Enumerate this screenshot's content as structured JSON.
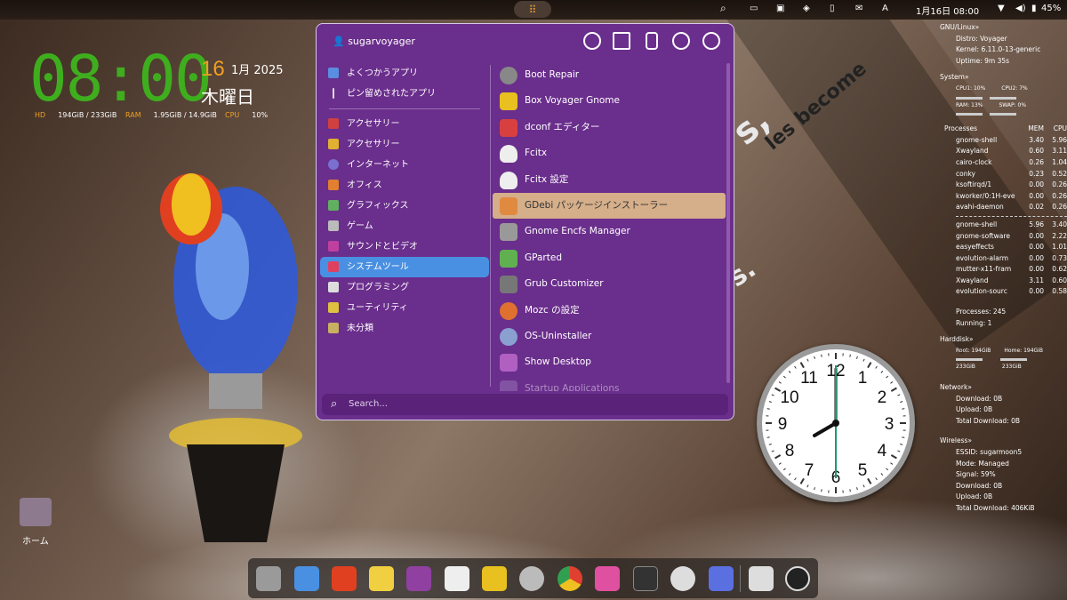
{
  "topbar": {
    "date_time": "1月16日 08:00",
    "battery": "45%",
    "input_method": "A"
  },
  "conky_left": {
    "time": "08:00",
    "day": "16",
    "month_year": "1月 2025",
    "weekday": "木曜日",
    "hd_label": "HD",
    "hd_value": "194GiB / 233GiB",
    "ram_label": "RAM",
    "ram_value": "1.95GiB / 14.9GiB",
    "cpu_label": "CPU",
    "cpu_value": "10%"
  },
  "menu": {
    "user": "sugarvoyager",
    "categories": [
      {
        "label": "よくつかうアプリ"
      },
      {
        "label": "ピン留めされたアプリ"
      },
      {
        "label": "アクセサリー"
      },
      {
        "label": "アクセサリー"
      },
      {
        "label": "インターネット"
      },
      {
        "label": "オフィス"
      },
      {
        "label": "グラフィックス"
      },
      {
        "label": "ゲーム"
      },
      {
        "label": "サウンドとビデオ"
      },
      {
        "label": "システムツール"
      },
      {
        "label": "プログラミング"
      },
      {
        "label": "ユーティリティ"
      },
      {
        "label": "未分類"
      }
    ],
    "apps": [
      {
        "label": "Boot Repair"
      },
      {
        "label": "Box Voyager Gnome"
      },
      {
        "label": "dconf エディター"
      },
      {
        "label": "Fcitx"
      },
      {
        "label": "Fcitx 設定"
      },
      {
        "label": "GDebi パッケージインストーラー"
      },
      {
        "label": "Gnome Encfs Manager"
      },
      {
        "label": "GParted"
      },
      {
        "label": "Grub Customizer"
      },
      {
        "label": "Mozc の設定"
      },
      {
        "label": "OS-Uninstaller"
      },
      {
        "label": "Show Desktop"
      },
      {
        "label": "Startup Applications"
      }
    ],
    "search_placeholder": "Search..."
  },
  "conky_right": {
    "gnu_title": "GNU/Linux»",
    "distro": "Distro: Voyager",
    "kernel": "Kernel: 6.11.0-13-generic",
    "uptime": "Uptime: 9m 35s",
    "system_title": "System»",
    "cpu1": "CPU1: 10%",
    "cpu2": "CPU2: 7%",
    "ram": "RAM: 13%",
    "swap": "SWAP: 0%",
    "processes_title": "Processes",
    "mem_h": "MEM",
    "cpu_h": "CPU",
    "procs_a": [
      {
        "name": "gnome-shell",
        "mem": "3.40",
        "cpu": "5.96"
      },
      {
        "name": "Xwayland",
        "mem": "0.60",
        "cpu": "3.11"
      },
      {
        "name": "cairo-clock",
        "mem": "0.26",
        "cpu": "1.04"
      },
      {
        "name": "conky",
        "mem": "0.23",
        "cpu": "0.52"
      },
      {
        "name": "ksoftirqd/1",
        "mem": "0.00",
        "cpu": "0.26"
      },
      {
        "name": "kworker/0:1H-eve",
        "mem": "0.00",
        "cpu": "0.26"
      },
      {
        "name": "avahi-daemon",
        "mem": "0.02",
        "cpu": "0.26"
      }
    ],
    "procs_b": [
      {
        "name": "gnome-shell",
        "mem": "5.96",
        "cpu": "3.40"
      },
      {
        "name": "gnome-software",
        "mem": "0.00",
        "cpu": "2.22"
      },
      {
        "name": "easyeffects",
        "mem": "0.00",
        "cpu": "1.01"
      },
      {
        "name": "evolution-alarm",
        "mem": "0.00",
        "cpu": "0.73"
      },
      {
        "name": "mutter-x11-fram",
        "mem": "0.00",
        "cpu": "0.62"
      },
      {
        "name": "Xwayland",
        "mem": "3.11",
        "cpu": "0.60"
      },
      {
        "name": "evolution-sourc",
        "mem": "0.00",
        "cpu": "0.58"
      }
    ],
    "processes_count": "Processes: 245",
    "running": "Running: 1",
    "harddisk_title": "Harddisk»",
    "root": "Root: 194GiB",
    "home": "Home: 194GiB",
    "root_total": "233GiB",
    "home_total": "233GiB",
    "network_title": "Network»",
    "download": "Download: 0B",
    "upload": "Upload: 0B",
    "total_download": "Total Download: 0B",
    "wireless_title": "Wireless»",
    "essid": "ESSID: sugarmoon5",
    "mode": "Mode: Managed",
    "signal": "Signal: 59%",
    "w_download": "Download: 0B",
    "w_upload": "Upload: 0B",
    "w_total": "Total Download: 406KiB"
  },
  "wallpaper_text": [
    "s,",
    "les become",
    "s."
  ],
  "desktop": {
    "home_label": "ホーム"
  },
  "clock_numbers": [
    "12",
    "1",
    "2",
    "3",
    "4",
    "5",
    "6",
    "7",
    "8",
    "9",
    "10",
    "11"
  ],
  "dock_icons": [
    "files-icon",
    "text-editor-icon",
    "brave-icon",
    "sticky-notes-icon",
    "video-player-icon",
    "software-store-icon",
    "box-voyager-icon",
    "settings-icon",
    "chrome-icon",
    "archive-manager-icon",
    "terminal-icon",
    "clock-icon",
    "screenshot-icon",
    "trash-icon",
    "ubuntu-icon"
  ]
}
